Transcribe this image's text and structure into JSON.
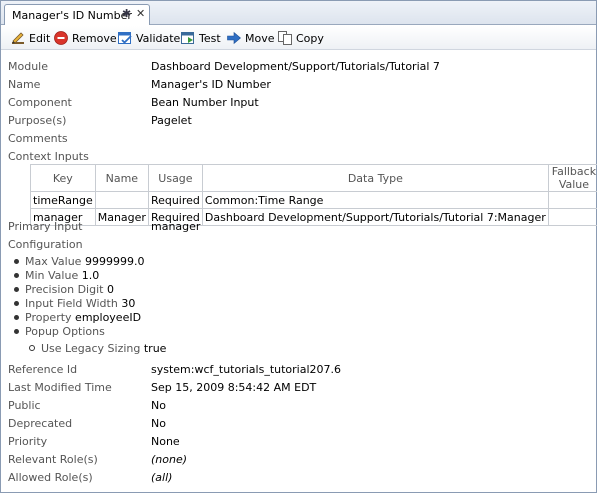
{
  "tab": {
    "title": "Manager's ID Number",
    "pin_glyph": "✱",
    "close_glyph": "✕"
  },
  "toolbar": {
    "edit": "Edit",
    "remove": "Remove",
    "validate": "Validate",
    "test": "Test",
    "move": "Move",
    "copy": "Copy"
  },
  "fields": {
    "module_label": "Module",
    "module_value": "Dashboard Development/Support/Tutorials/Tutorial 7",
    "name_label": "Name",
    "name_value": "Manager's ID Number",
    "component_label": "Component",
    "component_value": "Bean Number Input",
    "purpose_label": "Purpose(s)",
    "purpose_value": "Pagelet",
    "comments_label": "Comments",
    "context_inputs_label": "Context Inputs",
    "primary_input_label": "Primary Input",
    "primary_input_value": "manager",
    "configuration_label": "Configuration",
    "reference_id_label": "Reference Id",
    "reference_id_value": "system:wcf_tutorials_tutorial207.6",
    "last_modified_label": "Last Modified Time",
    "last_modified_value": "Sep 15, 2009 8:54:42 AM EDT",
    "public_label": "Public",
    "public_value": "No",
    "deprecated_label": "Deprecated",
    "deprecated_value": "No",
    "priority_label": "Priority",
    "priority_value": "None",
    "relevant_roles_label": "Relevant Role(s)",
    "relevant_roles_value": "(none)",
    "allowed_roles_label": "Allowed Role(s)",
    "allowed_roles_value": "(all)"
  },
  "context_table": {
    "headers": [
      "Key",
      "Name",
      "Usage",
      "Data Type",
      "Fallback Value"
    ],
    "rows": [
      [
        "timeRange",
        "",
        "Required",
        "Common:Time Range",
        ""
      ],
      [
        "manager",
        "Manager",
        "Required",
        "Dashboard Development/Support/Tutorials/Tutorial 7:Manager",
        ""
      ]
    ]
  },
  "configuration": {
    "max_value_key": "Max Value",
    "max_value": "9999999.0",
    "min_value_key": "Min Value",
    "min_value": "1.0",
    "precision_key": "Precision Digit",
    "precision": "0",
    "input_width_key": "Input Field Width",
    "input_width": "30",
    "property_key": "Property",
    "property": "employeeID",
    "popup_key": "Popup Options",
    "legacy_key": "Use Legacy Sizing",
    "legacy": "true"
  },
  "colors": {
    "border": "#8a9bb3",
    "label": "#555555",
    "icon_blue": "#2f6fc4",
    "icon_red": "#d9342b",
    "icon_green": "#3a9a3a"
  }
}
